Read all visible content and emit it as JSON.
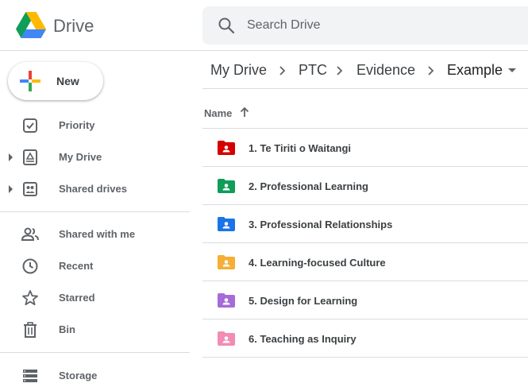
{
  "header": {
    "app_name": "Drive",
    "search_placeholder": "Search Drive"
  },
  "sidebar": {
    "new_label": "New",
    "items": [
      {
        "label": "Priority",
        "icon": "priority-icon"
      },
      {
        "label": "My Drive",
        "icon": "my-drive-icon",
        "expandable": true
      },
      {
        "label": "Shared drives",
        "icon": "shared-drives-icon",
        "expandable": true
      },
      {
        "label": "Shared with me",
        "icon": "shared-with-me-icon"
      },
      {
        "label": "Recent",
        "icon": "clock-icon"
      },
      {
        "label": "Starred",
        "icon": "star-icon"
      },
      {
        "label": "Bin",
        "icon": "trash-icon"
      },
      {
        "label": "Storage",
        "icon": "storage-icon"
      }
    ]
  },
  "breadcrumb": [
    "My Drive",
    "PTC",
    "Evidence",
    "Example"
  ],
  "table": {
    "column_name": "Name",
    "sort": "ascending",
    "rows": [
      {
        "label": "1. Te Tiriti o Waitangi",
        "color": "#d50000"
      },
      {
        "label": "2. Professional Learning",
        "color": "#0f9d58"
      },
      {
        "label": "3. Professional Relationships",
        "color": "#1a73e8"
      },
      {
        "label": "4. Learning-focused Culture",
        "color": "#f6ae36"
      },
      {
        "label": "5. Design for Learning",
        "color": "#a66bd8"
      },
      {
        "label": "6. Teaching as Inquiry",
        "color": "#f28cb5"
      }
    ]
  },
  "colors": {
    "icon_grey": "#5f6368",
    "divider": "#dadce0",
    "search_bg": "#f1f3f4"
  }
}
